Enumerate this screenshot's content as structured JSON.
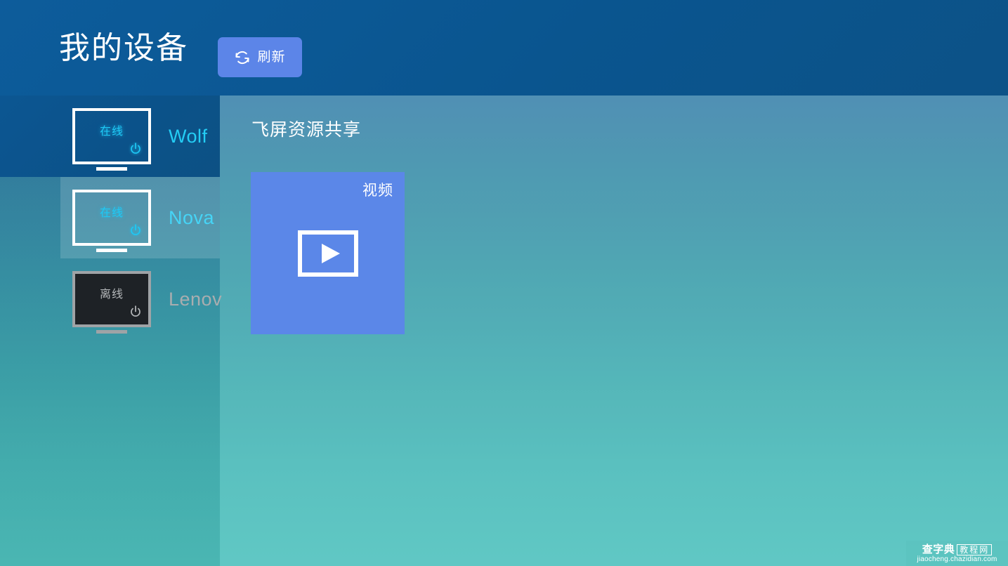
{
  "header": {
    "title": "我的设备",
    "refresh_label": "刷新",
    "refresh_icon": "refresh-icon",
    "background_color": "#0a558f",
    "button_color": "#5c85e8"
  },
  "sidebar": {
    "devices": [
      {
        "name": "Wolf",
        "status_label": "在线",
        "online": true,
        "selected": false,
        "power_icon": "power-icon",
        "name_color": "#24cdf5"
      },
      {
        "name": "Nova",
        "status_label": "在线",
        "online": true,
        "selected": true,
        "power_icon": "power-icon",
        "name_color": "#24cdf5"
      },
      {
        "name": "Lenov",
        "status_label": "离线",
        "online": false,
        "selected": false,
        "power_icon": "power-icon",
        "name_color": "#a9adaf"
      }
    ]
  },
  "main": {
    "section_title": "飞屏资源共享",
    "resources": [
      {
        "label": "视频",
        "glyph": "play-icon",
        "color": "#5b87e8"
      }
    ]
  },
  "watermark": {
    "brand": "查字典",
    "badge": "教程网",
    "url": "jiaocheng.chazidian.com"
  }
}
